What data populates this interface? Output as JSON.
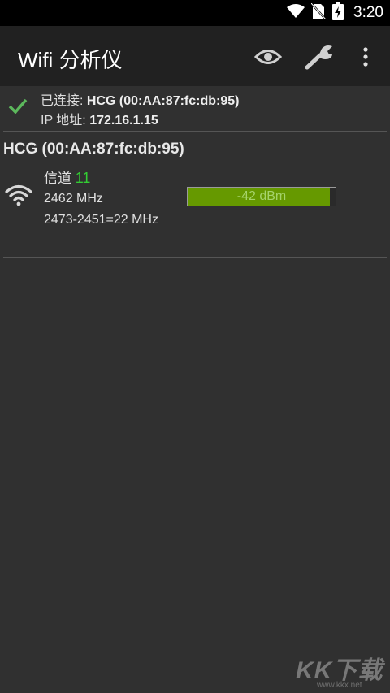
{
  "status_bar": {
    "time": "3:20"
  },
  "app_bar": {
    "title": "Wifi 分析仪",
    "actions": [
      "eye-icon",
      "wrench-icon",
      "overflow-menu-icon"
    ]
  },
  "connection": {
    "connected_label": "已连接:",
    "connected_value": "HCG (00:AA:87:fc:db:95)",
    "ip_label": "IP 地址:",
    "ip_value": "172.16.1.15"
  },
  "network": {
    "name": "HCG (00:AA:87:fc:db:95)",
    "channel_label": "信道",
    "channel": "11",
    "frequency": "2462 MHz",
    "range": "2473-2451=22 MHz",
    "signal": "-42 dBm",
    "signal_fraction": 0.96
  },
  "colors": {
    "background": "#303030",
    "app_bar": "#212121",
    "accent_green": "#33cc33",
    "meter_fill": "#669900",
    "check": "#5cb85c"
  },
  "watermark": {
    "logo": "KK下载",
    "url": "www.kkx.net"
  }
}
